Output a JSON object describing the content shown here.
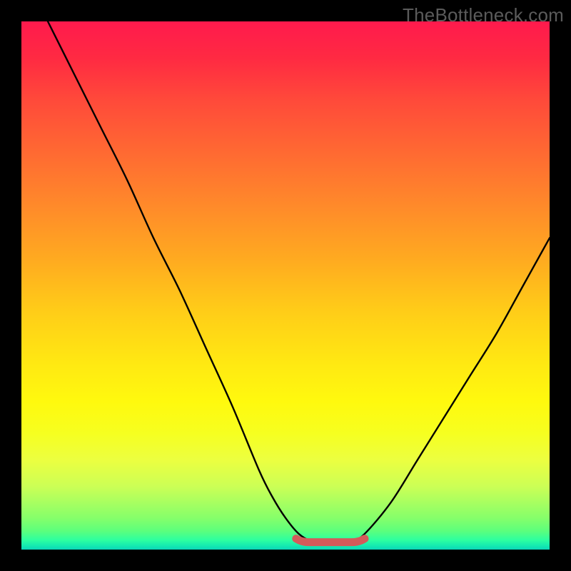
{
  "watermark": "TheBottleneck.com",
  "colors": {
    "background": "#000000",
    "gradient_top": "#ff1a4d",
    "gradient_mid_upper": "#ff8a2a",
    "gradient_mid": "#ffe912",
    "gradient_mid_lower": "#ccff55",
    "gradient_bottom": "#0bd5b8",
    "curve": "#000000",
    "trough_mark": "#d45a5a"
  },
  "chart_data": {
    "type": "line",
    "title": "",
    "xlabel": "",
    "ylabel": "",
    "xlim": [
      0,
      100
    ],
    "ylim": [
      0,
      100
    ],
    "x": [
      5,
      10,
      15,
      20,
      25,
      30,
      35,
      40,
      45,
      47.5,
      50,
      52.5,
      55,
      57.5,
      60,
      62.5,
      65,
      70,
      75,
      80,
      85,
      90,
      95,
      100
    ],
    "y": [
      100,
      90,
      80,
      70,
      59,
      49,
      38,
      27,
      15,
      10,
      6,
      3,
      1.5,
      1,
      1,
      1.5,
      3,
      9,
      17,
      25,
      33,
      41,
      50,
      59
    ],
    "trough_band": {
      "x_start": 52,
      "x_end": 65,
      "y": 1.4
    },
    "gradient_meaning": "vertical heat gradient background (red high, green low)",
    "note": "V-shaped bottleneck curve; minimum (optimal zone) marked with red band near y≈1.4 around x≈52–65"
  }
}
